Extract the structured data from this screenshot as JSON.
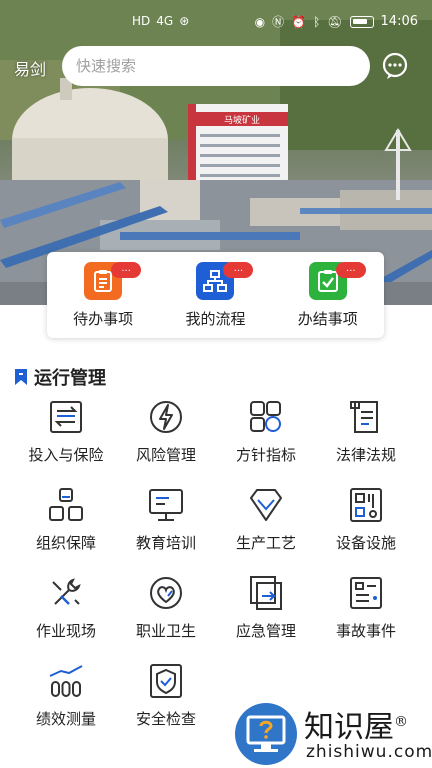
{
  "status_bar": {
    "left_indicators": [
      "HD",
      "4G",
      "⊛"
    ],
    "time": "14:06"
  },
  "header": {
    "city": "易剑",
    "search_placeholder": "快速搜索"
  },
  "banner": {
    "building_sign": "马坡矿业"
  },
  "quick_actions": [
    {
      "label": "待办事项",
      "badge": "...",
      "color": "#F26B21",
      "icon": "todo-list-icon"
    },
    {
      "label": "我的流程",
      "badge": "...",
      "color": "#1F5FD6",
      "icon": "flow-chart-icon"
    },
    {
      "label": "办结事项",
      "badge": "...",
      "color": "#2DB23E",
      "icon": "completed-check-icon"
    }
  ],
  "section": {
    "title": "运行管理"
  },
  "modules": [
    {
      "label": "投入与保险",
      "icon": "investment-icon"
    },
    {
      "label": "风险管理",
      "icon": "risk-lightning-icon"
    },
    {
      "label": "方针指标",
      "icon": "policy-indicator-icon"
    },
    {
      "label": "法律法规",
      "icon": "law-scroll-icon"
    },
    {
      "label": "组织保障",
      "icon": "organization-icon"
    },
    {
      "label": "教育培训",
      "icon": "training-monitor-icon"
    },
    {
      "label": "生产工艺",
      "icon": "production-diamond-icon"
    },
    {
      "label": "设备设施",
      "icon": "equipment-icon"
    },
    {
      "label": "作业现场",
      "icon": "tools-icon"
    },
    {
      "label": "职业卫生",
      "icon": "health-heart-icon"
    },
    {
      "label": "应急管理",
      "icon": "emergency-exit-icon"
    },
    {
      "label": "事故事件",
      "icon": "incident-list-icon"
    },
    {
      "label": "绩效测量",
      "icon": "performance-chart-icon"
    },
    {
      "label": "安全检查",
      "icon": "safety-shield-icon"
    }
  ],
  "watermark": {
    "brand": "知识屋",
    "registered": "®",
    "url": "zhishiwu.com"
  },
  "colors": {
    "accent_blue": "#1F5FD6",
    "icon_stroke": "#333333",
    "badge_red": "#E53935"
  }
}
